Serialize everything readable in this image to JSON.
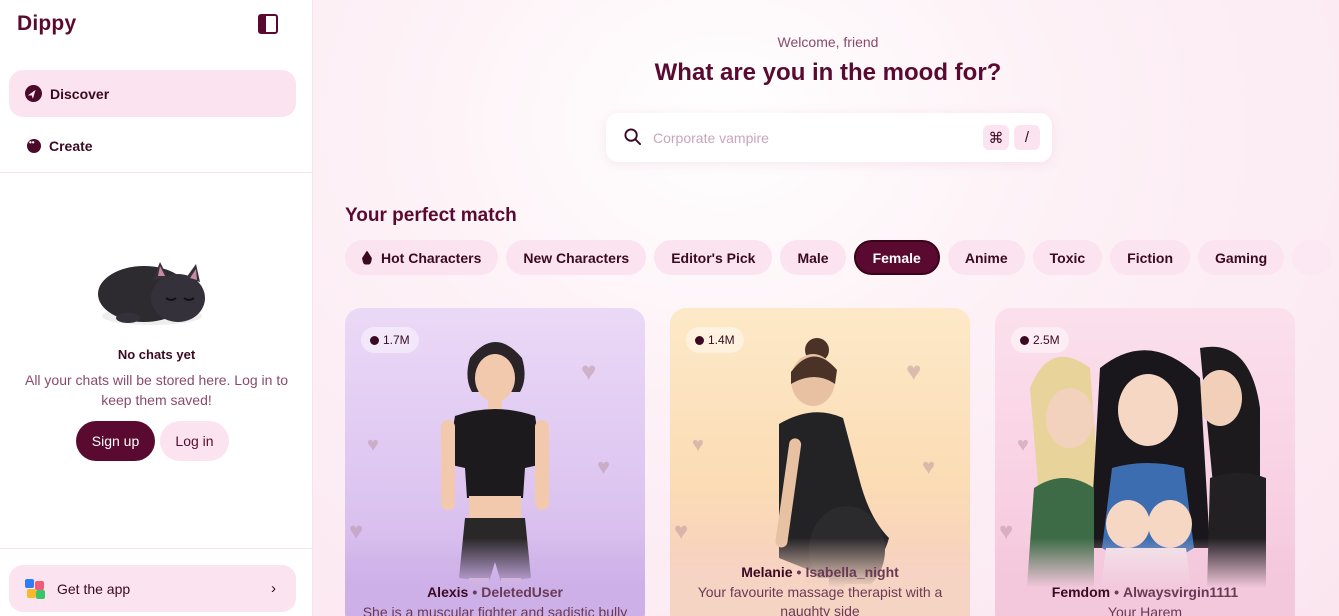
{
  "app": {
    "name": "Dippy"
  },
  "sidebar": {
    "nav": [
      {
        "label": "Discover",
        "icon": "compass-icon",
        "active": true
      },
      {
        "label": "Create",
        "icon": "face-icon",
        "active": false
      }
    ],
    "empty_state": {
      "title": "No chats yet",
      "description": "All your chats will be stored here. Log in to keep them saved!",
      "signup_label": "Sign up",
      "login_label": "Log in"
    },
    "get_app_label": "Get the app"
  },
  "main": {
    "welcome": "Welcome, friend",
    "headline": "What are you in the mood for?",
    "search": {
      "placeholder": "Corporate vampire",
      "shortcut_key1": "⌘",
      "shortcut_key2": "/"
    },
    "section_title": "Your perfect match",
    "chips": [
      {
        "label": "Hot Characters",
        "icon": "fire-icon",
        "active": false
      },
      {
        "label": "New Characters",
        "active": false
      },
      {
        "label": "Editor's Pick",
        "active": false
      },
      {
        "label": "Male",
        "active": false
      },
      {
        "label": "Female",
        "active": true
      },
      {
        "label": "Anime",
        "active": false
      },
      {
        "label": "Toxic",
        "active": false
      },
      {
        "label": "Fiction",
        "active": false
      },
      {
        "label": "Gaming",
        "active": false
      }
    ],
    "cards": [
      {
        "count": "1.7M",
        "name": "Alexis",
        "creator": "DeletedUser",
        "description": "She is a muscular fighter and sadistic bully"
      },
      {
        "count": "1.4M",
        "name": "Melanie",
        "creator": "Isabella_night",
        "description": "Your favourite massage therapist with a naughty side"
      },
      {
        "count": "2.5M",
        "name": "Femdom",
        "creator": "Alwaysvirgin1111",
        "description": "Your Harem"
      }
    ]
  },
  "colors": {
    "brand": "#5a0a30",
    "pink_surface": "#fbe3ef",
    "muted_text": "#8a4a6b"
  }
}
